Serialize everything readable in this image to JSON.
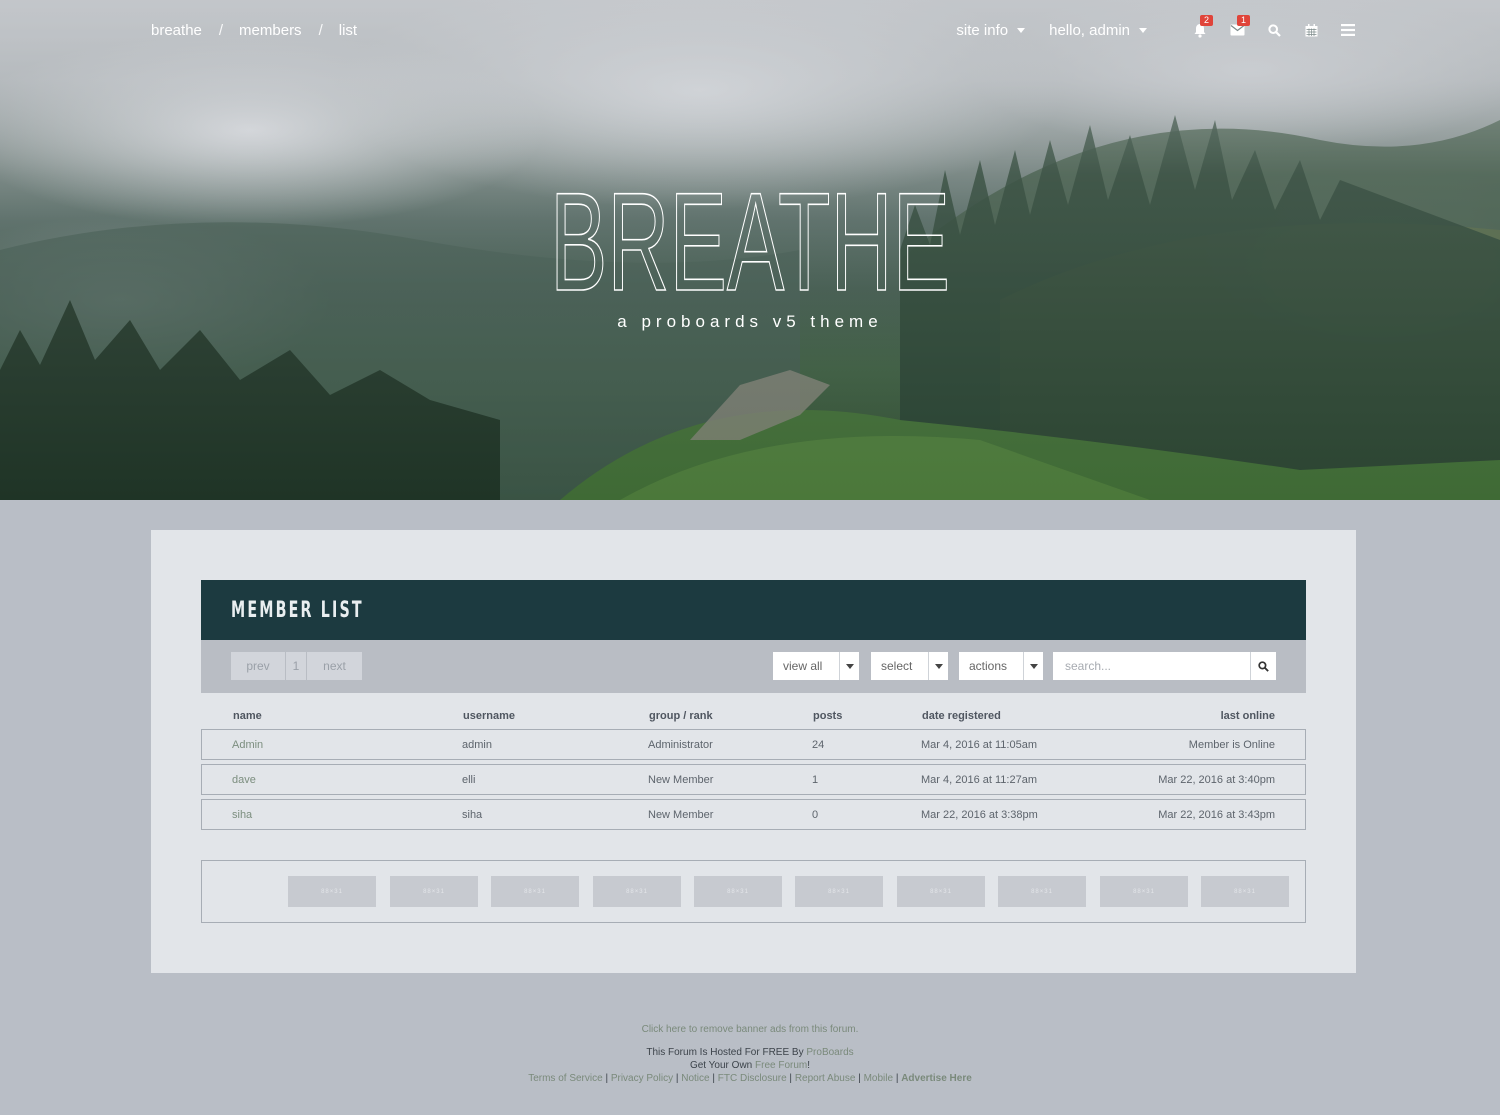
{
  "breadcrumb": [
    "breathe",
    "members",
    "list"
  ],
  "breadcrumb_sep": "/",
  "topnav": {
    "site_info": "site info",
    "hello": "hello, admin",
    "notifications_count": "2",
    "messages_count": "1",
    "icons": [
      "bell-icon",
      "envelope-icon",
      "search-icon",
      "calendar-icon",
      "menu-icon"
    ]
  },
  "hero": {
    "title": "BREATHE",
    "subtitle": "a proboards v5 theme"
  },
  "member_list": {
    "title": "MEMBER LIST",
    "pager": {
      "prev": "prev",
      "page": "1",
      "next": "next"
    },
    "filters": {
      "view": "view all",
      "select": "select",
      "actions": "actions"
    },
    "search_placeholder": "search...",
    "columns": [
      "name",
      "username",
      "group / rank",
      "posts",
      "date registered",
      "last online"
    ],
    "rows": [
      [
        "Admin",
        "admin",
        "Administrator",
        "24",
        "Mar 4, 2016 at 11:05am",
        "Member is Online"
      ],
      [
        "dave",
        "elli",
        "New Member",
        "1",
        "Mar 4, 2016 at 11:27am",
        "Mar 22, 2016 at 3:40pm"
      ],
      [
        "siha",
        "siha",
        "New Member",
        "0",
        "Mar 22, 2016 at 3:38pm",
        "Mar 22, 2016 at 3:43pm"
      ]
    ]
  },
  "ads": [
    "88×31",
    "88×31",
    "88×31",
    "88×31",
    "88×31",
    "88×31",
    "88×31",
    "88×31",
    "88×31",
    "88×31"
  ],
  "footer": {
    "remove_ads": "Click here to remove banner ads from this forum.",
    "hosted_prefix": "This Forum Is Hosted For FREE By",
    "hosted_link": "ProBoards",
    "own_prefix": "Get Your Own",
    "own_link": "Free Forum",
    "own_suffix": "!",
    "links": [
      "Terms of Service",
      "Privacy Policy",
      "Notice",
      "FTC Disclosure",
      "Report Abuse",
      "Mobile",
      "Advertise Here"
    ]
  },
  "colors": {
    "header_bg": "#1c3a40",
    "page_bg": "#b9bec6",
    "panel_bg": "#e2e5e9",
    "badge": "#e0443a",
    "link_green": "#7a8a7b"
  }
}
